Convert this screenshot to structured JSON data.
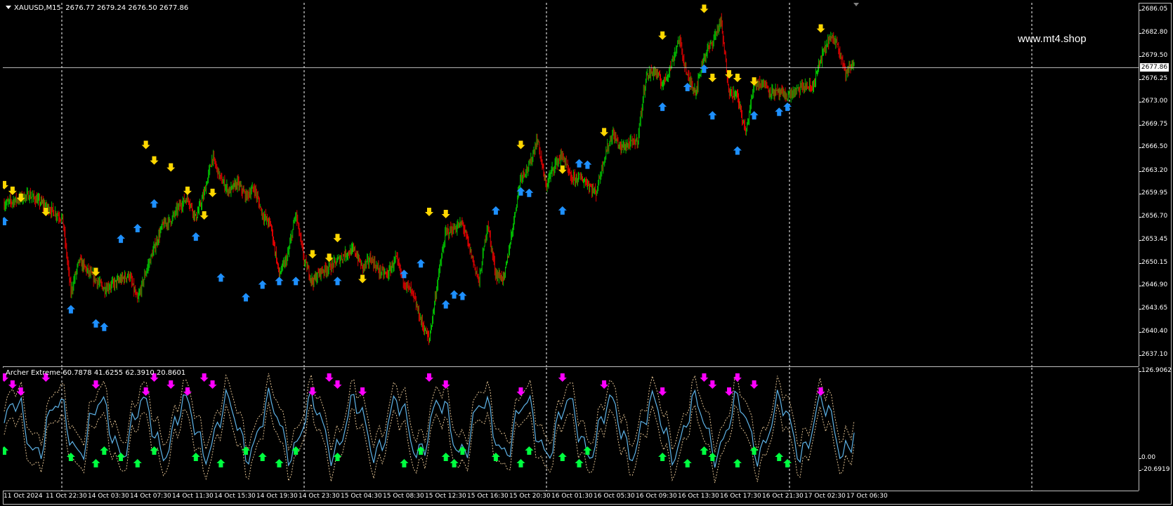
{
  "main": {
    "symbol": "XAUUSD,M15",
    "ohlc": "2676.77 2679.24 2676.50 2677.86",
    "watermark": "www.mt4.shop",
    "current_price": "2677.86",
    "price_ticks": [
      "2686.05",
      "2682.80",
      "2679.50",
      "2676.25",
      "2673.00",
      "2669.75",
      "2666.50",
      "2663.20",
      "2659.95",
      "2656.70",
      "2653.45",
      "2650.15",
      "2646.90",
      "2643.65",
      "2640.40",
      "2637.10"
    ],
    "colors": {
      "bull": "#00c000",
      "bear": "#e00000",
      "arrow_up": "#1e90ff",
      "arrow_down": "#ffd700",
      "grid": "#ffffff"
    }
  },
  "indicator": {
    "label": "Archer Extreme 60.7878 41.6255 62.3910 20.8601",
    "scale_top": "126.9062",
    "scale_zero": "0.00",
    "scale_bottom": "-20.6919",
    "colors": {
      "line": "#5fb4e8",
      "band": "#e0c090",
      "arrow_up": "#00ff40",
      "arrow_down": "#ff00ff"
    }
  },
  "time_axis": [
    "11 Oct 2024",
    "11 Oct 22:30",
    "14 Oct 03:30",
    "14 Oct 07:30",
    "14 Oct 11:30",
    "14 Oct 15:30",
    "14 Oct 19:30",
    "14 Oct 23:30",
    "15 Oct 04:30",
    "15 Oct 08:30",
    "15 Oct 12:30",
    "15 Oct 16:30",
    "15 Oct 20:30",
    "16 Oct 01:30",
    "16 Oct 05:30",
    "16 Oct 09:30",
    "16 Oct 13:30",
    "16 Oct 17:30",
    "16 Oct 21:30",
    "17 Oct 02:30",
    "17 Oct 06:30"
  ],
  "chart_data": {
    "type": "candlestick",
    "symbol": "XAUUSD",
    "timeframe": "M15",
    "ylim": [
      2637.1,
      2686.05
    ],
    "close_path": [
      [
        0,
        2658.5
      ],
      [
        3,
        2659.8
      ],
      [
        5,
        2658.2
      ],
      [
        7,
        2656.5
      ],
      [
        8,
        2646.0
      ],
      [
        9,
        2650.5
      ],
      [
        10,
        2649.0
      ],
      [
        12,
        2646.5
      ],
      [
        14,
        2647.8
      ],
      [
        15,
        2648.5
      ],
      [
        16,
        2644.8
      ],
      [
        17,
        2648.9
      ],
      [
        19,
        2655.5
      ],
      [
        20,
        2656.2
      ],
      [
        21,
        2658.2
      ],
      [
        22,
        2659.5
      ],
      [
        23,
        2656.5
      ],
      [
        24,
        2660.0
      ],
      [
        25,
        2665.2
      ],
      [
        26,
        2662.0
      ],
      [
        27,
        2660.3
      ],
      [
        28,
        2661.5
      ],
      [
        29,
        2659.6
      ],
      [
        30,
        2660.8
      ],
      [
        31,
        2657.0
      ],
      [
        32,
        2655.5
      ],
      [
        33,
        2648.5
      ],
      [
        34,
        2651.0
      ],
      [
        35,
        2657.2
      ],
      [
        36,
        2650.5
      ],
      [
        37,
        2647.5
      ],
      [
        38,
        2649.0
      ],
      [
        39,
        2649.5
      ],
      [
        40,
        2650.5
      ],
      [
        41,
        2651.5
      ],
      [
        42,
        2652.0
      ],
      [
        43,
        2649.5
      ],
      [
        44,
        2650.8
      ],
      [
        45,
        2649.0
      ],
      [
        46,
        2648.5
      ],
      [
        47,
        2650.8
      ],
      [
        48,
        2647.5
      ],
      [
        49,
        2645.8
      ],
      [
        50,
        2642.0
      ],
      [
        51,
        2639.2
      ],
      [
        52,
        2647.5
      ],
      [
        53,
        2654.5
      ],
      [
        54,
        2655.0
      ],
      [
        55,
        2655.8
      ],
      [
        56,
        2651.5
      ],
      [
        57,
        2647.5
      ],
      [
        58,
        2655.8
      ],
      [
        59,
        2648.5
      ],
      [
        60,
        2648.0
      ],
      [
        61,
        2655.0
      ],
      [
        62,
        2662.5
      ],
      [
        63,
        2663.8
      ],
      [
        64,
        2667.8
      ],
      [
        65,
        2661.0
      ],
      [
        66,
        2664.0
      ],
      [
        67,
        2665.5
      ],
      [
        68,
        2662.0
      ],
      [
        69,
        2662.3
      ],
      [
        70,
        2661.5
      ],
      [
        71,
        2660.0
      ],
      [
        72,
        2665.0
      ],
      [
        73,
        2668.5
      ],
      [
        74,
        2666.5
      ],
      [
        75,
        2667.0
      ],
      [
        76,
        2667.5
      ],
      [
        77,
        2676.5
      ],
      [
        78,
        2677.5
      ],
      [
        79,
        2675.5
      ],
      [
        80,
        2678.0
      ],
      [
        81,
        2682.0
      ],
      [
        82,
        2676.5
      ],
      [
        83,
        2674.5
      ],
      [
        84,
        2679.5
      ],
      [
        85,
        2681.5
      ],
      [
        86,
        2684.5
      ],
      [
        87,
        2674.5
      ],
      [
        88,
        2673.8
      ],
      [
        89,
        2668.5
      ],
      [
        90,
        2675.5
      ],
      [
        91,
        2675.8
      ],
      [
        92,
        2674.5
      ],
      [
        93,
        2674.2
      ],
      [
        94,
        2673.8
      ],
      [
        95,
        2674.5
      ],
      [
        96,
        2675.2
      ],
      [
        97,
        2675.0
      ],
      [
        98,
        2679.0
      ],
      [
        99,
        2682.0
      ],
      [
        100,
        2681.5
      ],
      [
        101,
        2677.0
      ],
      [
        102,
        2678.5
      ]
    ],
    "up_arrows": [
      [
        0,
        2657
      ],
      [
        8,
        2644.5
      ],
      [
        11,
        2642.5
      ],
      [
        12,
        2642
      ],
      [
        14,
        2654.5
      ],
      [
        16,
        2656
      ],
      [
        18,
        2659.5
      ],
      [
        23,
        2654.8
      ],
      [
        26,
        2649
      ],
      [
        29,
        2646.2
      ],
      [
        31,
        2648
      ],
      [
        33,
        2648.5
      ],
      [
        35,
        2648.5
      ],
      [
        40,
        2648.5
      ],
      [
        48,
        2649.5
      ],
      [
        50,
        2651
      ],
      [
        53,
        2645.2
      ],
      [
        54,
        2646.6
      ],
      [
        55,
        2646.4
      ],
      [
        59,
        2658.5
      ],
      [
        62,
        2661.2
      ],
      [
        63,
        2661
      ],
      [
        67,
        2658.5
      ],
      [
        69,
        2665.2
      ],
      [
        70,
        2665
      ],
      [
        79,
        2673.2
      ],
      [
        82,
        2676
      ],
      [
        84,
        2678.6
      ],
      [
        85,
        2672
      ],
      [
        88,
        2667
      ],
      [
        90,
        2672
      ],
      [
        93,
        2672.5
      ],
      [
        94,
        2673.2
      ]
    ],
    "down_arrows": [
      [
        0,
        2660.3
      ],
      [
        1,
        2659.5
      ],
      [
        2,
        2658.5
      ],
      [
        5,
        2656.5
      ],
      [
        11,
        2648
      ],
      [
        17,
        2666
      ],
      [
        18,
        2663.8
      ],
      [
        20,
        2662.8
      ],
      [
        22,
        2659.5
      ],
      [
        24,
        2656
      ],
      [
        25,
        2659.2
      ],
      [
        37,
        2650.5
      ],
      [
        39,
        2650
      ],
      [
        40,
        2652.8
      ],
      [
        43,
        2647
      ],
      [
        51,
        2656.5
      ],
      [
        53,
        2656.2
      ],
      [
        62,
        2666
      ],
      [
        67,
        2662.5
      ],
      [
        72,
        2667.8
      ],
      [
        79,
        2681.5
      ],
      [
        84,
        2685.3
      ],
      [
        85,
        2675.5
      ],
      [
        87,
        2676
      ],
      [
        88,
        2675.5
      ],
      [
        90,
        2675
      ],
      [
        98,
        2682.5
      ]
    ],
    "indicator": {
      "name": "Archer Extreme",
      "values": [
        60.7878,
        41.6255,
        62.391,
        20.8601
      ],
      "ylim": [
        -20.6919,
        126.9062
      ]
    }
  }
}
